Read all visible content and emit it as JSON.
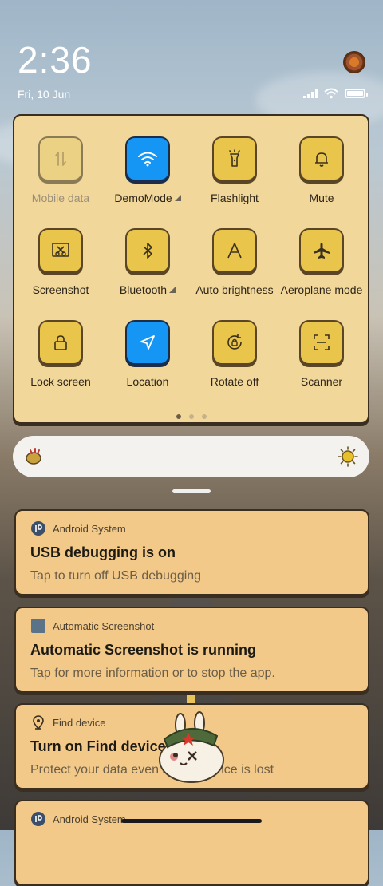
{
  "status": {
    "time": "2:36",
    "date": "Fri, 10 Jun"
  },
  "quick_settings": {
    "tiles": [
      {
        "label": "Mobile data",
        "icon": "mobile-data-icon",
        "state": "disabled"
      },
      {
        "label": "DemoMode",
        "icon": "wifi-icon",
        "state": "on",
        "expandable": true
      },
      {
        "label": "Flashlight",
        "icon": "flashlight-icon",
        "state": "off"
      },
      {
        "label": "Mute",
        "icon": "bell-icon",
        "state": "off"
      },
      {
        "label": "Screenshot",
        "icon": "screenshot-icon",
        "state": "off"
      },
      {
        "label": "Bluetooth",
        "icon": "bluetooth-icon",
        "state": "off",
        "expandable": true
      },
      {
        "label": "Auto brightness",
        "icon": "auto-brightness-icon",
        "state": "off"
      },
      {
        "label": "Aeroplane mode",
        "icon": "airplane-icon",
        "state": "off"
      },
      {
        "label": "Lock screen",
        "icon": "lock-icon",
        "state": "off"
      },
      {
        "label": "Location",
        "icon": "location-icon",
        "state": "on"
      },
      {
        "label": "Rotate off",
        "icon": "rotate-icon",
        "state": "off"
      },
      {
        "label": "Scanner",
        "icon": "scanner-icon",
        "state": "off"
      }
    ],
    "page_count": 3,
    "active_page": 1
  },
  "notifications": [
    {
      "app": "Android System",
      "title": "USB debugging is on",
      "text": "Tap to turn off USB debugging",
      "icon": "android-system-icon"
    },
    {
      "app": "Automatic Screenshot",
      "title": "Automatic Screenshot is running",
      "text": "Tap for more information or to stop the app.",
      "icon": "app-square-icon"
    },
    {
      "app": "Find device",
      "title": "Turn on Find device",
      "text": "Protect your data even if your device is lost",
      "icon": "location-pin-icon"
    },
    {
      "app": "Android System",
      "title": "",
      "text": "",
      "icon": "android-system-icon"
    }
  ],
  "colors": {
    "panel": "#f2d79a",
    "tile": "#e9c64b",
    "tile_active": "#1596f5",
    "notification": "#f3c98a"
  }
}
